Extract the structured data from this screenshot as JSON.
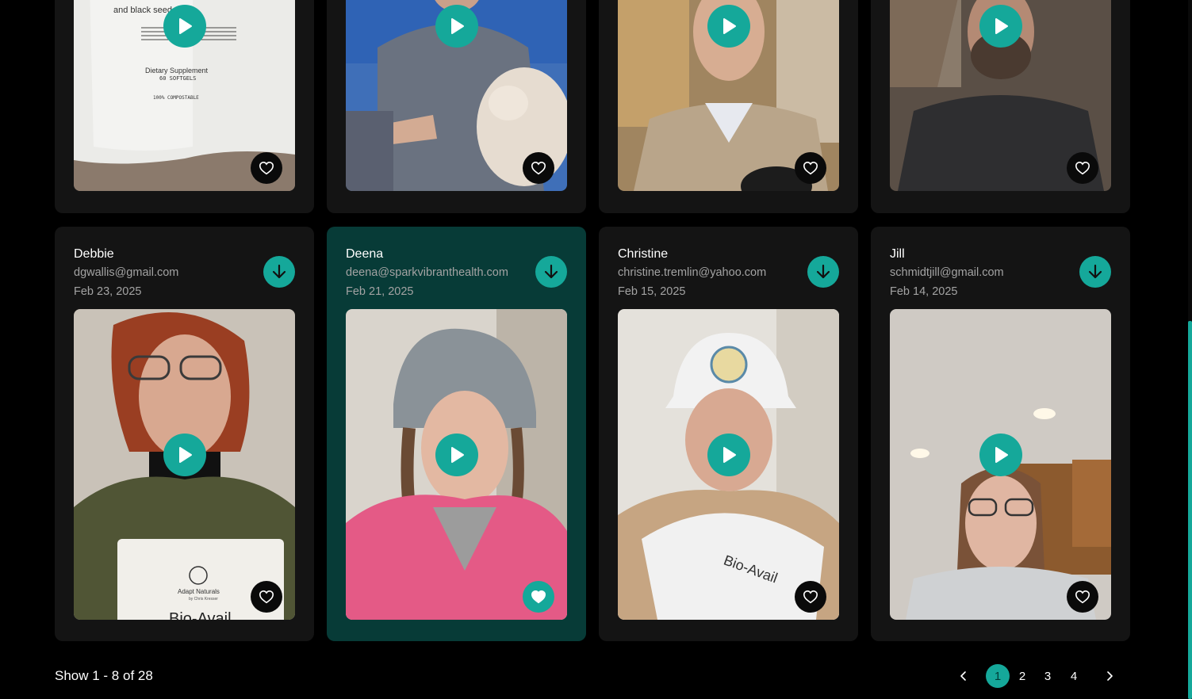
{
  "top_cards": [
    {
      "fav": false
    },
    {
      "fav": false
    },
    {
      "fav": false
    },
    {
      "fav": false
    }
  ],
  "cards": [
    {
      "name": "Debbie",
      "email": "dgwallis@gmail.com",
      "date": "Feb 23, 2025",
      "fav": false,
      "selected": false
    },
    {
      "name": "Deena",
      "email": "deena@sparkvibranthealth.com",
      "date": "Feb 21, 2025",
      "fav": true,
      "selected": true
    },
    {
      "name": "Christine",
      "email": "christine.tremlin@yahoo.com",
      "date": "Feb 15, 2025",
      "fav": false,
      "selected": false
    },
    {
      "name": "Jill",
      "email": "schmidtjill@gmail.com",
      "date": "Feb 14, 2025",
      "fav": false,
      "selected": false
    }
  ],
  "product_text": {
    "top_supplement": "Dietary Supplement",
    "top_softgels": "60 SOFTGELS",
    "top_compostable": "100% COMPOSTABLE",
    "top_ingredients": "and black seed",
    "brand": "Adapt Naturals",
    "brand_sub": "by Chris Kresser",
    "product": "Bio-Avail"
  },
  "footer": {
    "show_text": "Show 1 - 8 of 28",
    "pages": [
      "1",
      "2",
      "3",
      "4"
    ],
    "current_page": "1"
  },
  "colors": {
    "accent": "#15a89a",
    "card_bg": "#141414",
    "selected_bg": "#073b37",
    "page_bg": "#000000"
  },
  "icons": {
    "play": "play-icon",
    "download": "download-arrow-icon",
    "favorite": "heart-icon",
    "prev": "chevron-left-icon",
    "next": "chevron-right-icon"
  }
}
